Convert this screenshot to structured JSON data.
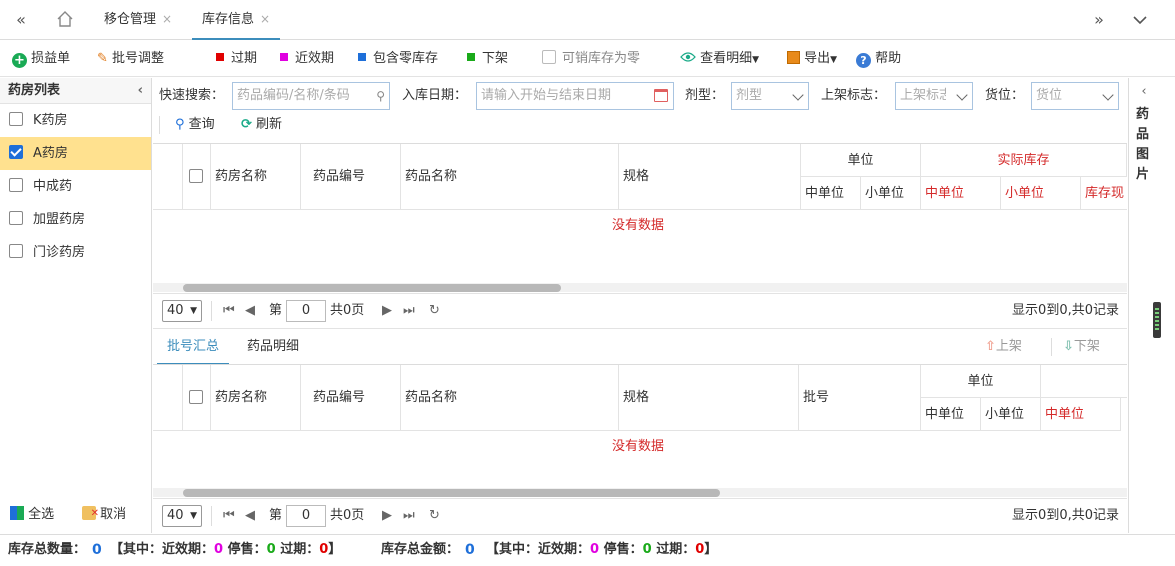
{
  "tabs": [
    {
      "label": "移仓管理",
      "close": "×"
    },
    {
      "label": "库存信息",
      "close": "×"
    }
  ],
  "toolbar": {
    "loss_gain": "损益单",
    "batch_adjust": "批号调整",
    "legend_expired": "过期",
    "legend_near_expiry": "近效期",
    "legend_zero_stock": "包含零库存",
    "legend_off_shelf": "下架",
    "sellable_zero": "可销库存为零",
    "view_detail": "查看明细",
    "export": "导出",
    "help": "帮助",
    "colors": {
      "expired": "#e00000",
      "near_expiry": "#e000e0",
      "zero_stock": "#1e6fd9",
      "off_shelf": "#1aaa1a"
    }
  },
  "sidebar": {
    "title": "药房列表",
    "items": [
      {
        "label": "K药房",
        "checked": false
      },
      {
        "label": "A药房",
        "checked": true
      },
      {
        "label": "中成药",
        "checked": false
      },
      {
        "label": "加盟药房",
        "checked": false
      },
      {
        "label": "门诊药房",
        "checked": false
      }
    ],
    "select_all": "全选",
    "cancel": "取消"
  },
  "filters": {
    "quick_search_label": "快速搜索：",
    "quick_search_placeholder": "药品编码/名称/条码",
    "in_date_label": "入库日期：",
    "in_date_placeholder": "请输入开始与结束日期",
    "dosage_label": "剂型：",
    "dosage_placeholder": "剂型",
    "shelf_label": "上架标志：",
    "shelf_placeholder": "上架标志",
    "location_label": "货位：",
    "location_placeholder": "货位",
    "query": "查询",
    "refresh": "刷新"
  },
  "grid1": {
    "headers": {
      "pharmacy_name": "药房名称",
      "drug_code": "药品编号",
      "drug_name": "药品名称",
      "spec": "规格",
      "unit": "单位",
      "actual_stock": "实际库存",
      "mid_unit": "中单位",
      "small_unit": "小单位",
      "stock_mid_unit": "中单位",
      "stock_small_unit": "小单位",
      "stock_current": "库存现"
    },
    "no_data": "没有数据"
  },
  "pager1": {
    "page_size": "40",
    "page_prefix": "第",
    "page_value": "0",
    "page_suffix": "共0页",
    "summary": "显示0到0,共0记录"
  },
  "subtabs": {
    "batch_summary": "批号汇总",
    "drug_detail": "药品明细",
    "shelf_on": "上架",
    "shelf_off": "下架"
  },
  "grid2": {
    "headers": {
      "pharmacy_name": "药房名称",
      "drug_code": "药品编号",
      "drug_name": "药品名称",
      "spec": "规格",
      "batch": "批号",
      "unit": "单位",
      "mid_unit": "中单位",
      "small_unit": "小单位",
      "stock_mid_unit": "中单位"
    },
    "no_data": "没有数据"
  },
  "pager2": {
    "page_size": "40",
    "page_prefix": "第",
    "page_value": "0",
    "page_suffix": "共0页",
    "summary": "显示0到0,共0记录"
  },
  "right_panel": {
    "title": "药品图片"
  },
  "status": {
    "total_qty_label": "库存总数量：",
    "total_qty": "0",
    "qty_open": "【其中：近效期：",
    "qty_near": "0",
    "qty_stop_label": "停售：",
    "qty_stop": "0",
    "qty_exp_label": "过期：",
    "qty_exp": "0",
    "close": "】",
    "total_amt_label": "库存总金额：",
    "total_amt": "0",
    "amt_open": "【其中：近效期：",
    "amt_near": "0",
    "amt_stop_label": "停售：",
    "amt_stop": "0",
    "amt_exp_label": "过期：",
    "amt_exp": "0"
  }
}
